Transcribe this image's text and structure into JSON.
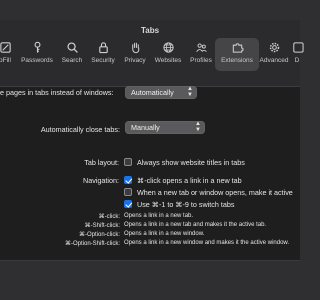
{
  "window": {
    "title": "Tabs"
  },
  "toolbar": [
    {
      "label": "oFill",
      "icon": "autofill-icon"
    },
    {
      "label": "Passwords",
      "icon": "key-icon"
    },
    {
      "label": "Search",
      "icon": "search-icon"
    },
    {
      "label": "Security",
      "icon": "lock-icon"
    },
    {
      "label": "Privacy",
      "icon": "hand-icon"
    },
    {
      "label": "Websites",
      "icon": "globe-icon"
    },
    {
      "label": "Profiles",
      "icon": "profiles-icon"
    },
    {
      "label": "Extensions",
      "icon": "puzzle-icon"
    },
    {
      "label": "Advanced",
      "icon": "gear-icon"
    },
    {
      "label": "D",
      "icon": "developer-icon"
    }
  ],
  "settings": {
    "open_pages_label": "e pages in tabs instead of windows:",
    "open_pages_value": "Automatically",
    "auto_close_label": "Automatically close tabs:",
    "auto_close_value": "Manually",
    "tab_layout_label": "Tab layout:",
    "always_show_titles": "Always show website titles in tabs",
    "navigation_label": "Navigation:",
    "cmd_click": "⌘-click opens a link in a new tab",
    "new_tab_active": "When a new tab or window opens, make it active",
    "use_cmd_numbers": "Use ⌘-1 to ⌘-9 to switch tabs"
  },
  "shortcuts": [
    {
      "key": "⌘-click:",
      "desc": "Opens a link in a new tab."
    },
    {
      "key": "⌘-Shift-click:",
      "desc": "Opens a link in a new tab and makes it the active tab."
    },
    {
      "key": "⌘-Option-click:",
      "desc": "Opens a link in a new window."
    },
    {
      "key": "⌘-Option-Shift-click:",
      "desc": "Opens a link in a new window and makes it the active window."
    }
  ]
}
